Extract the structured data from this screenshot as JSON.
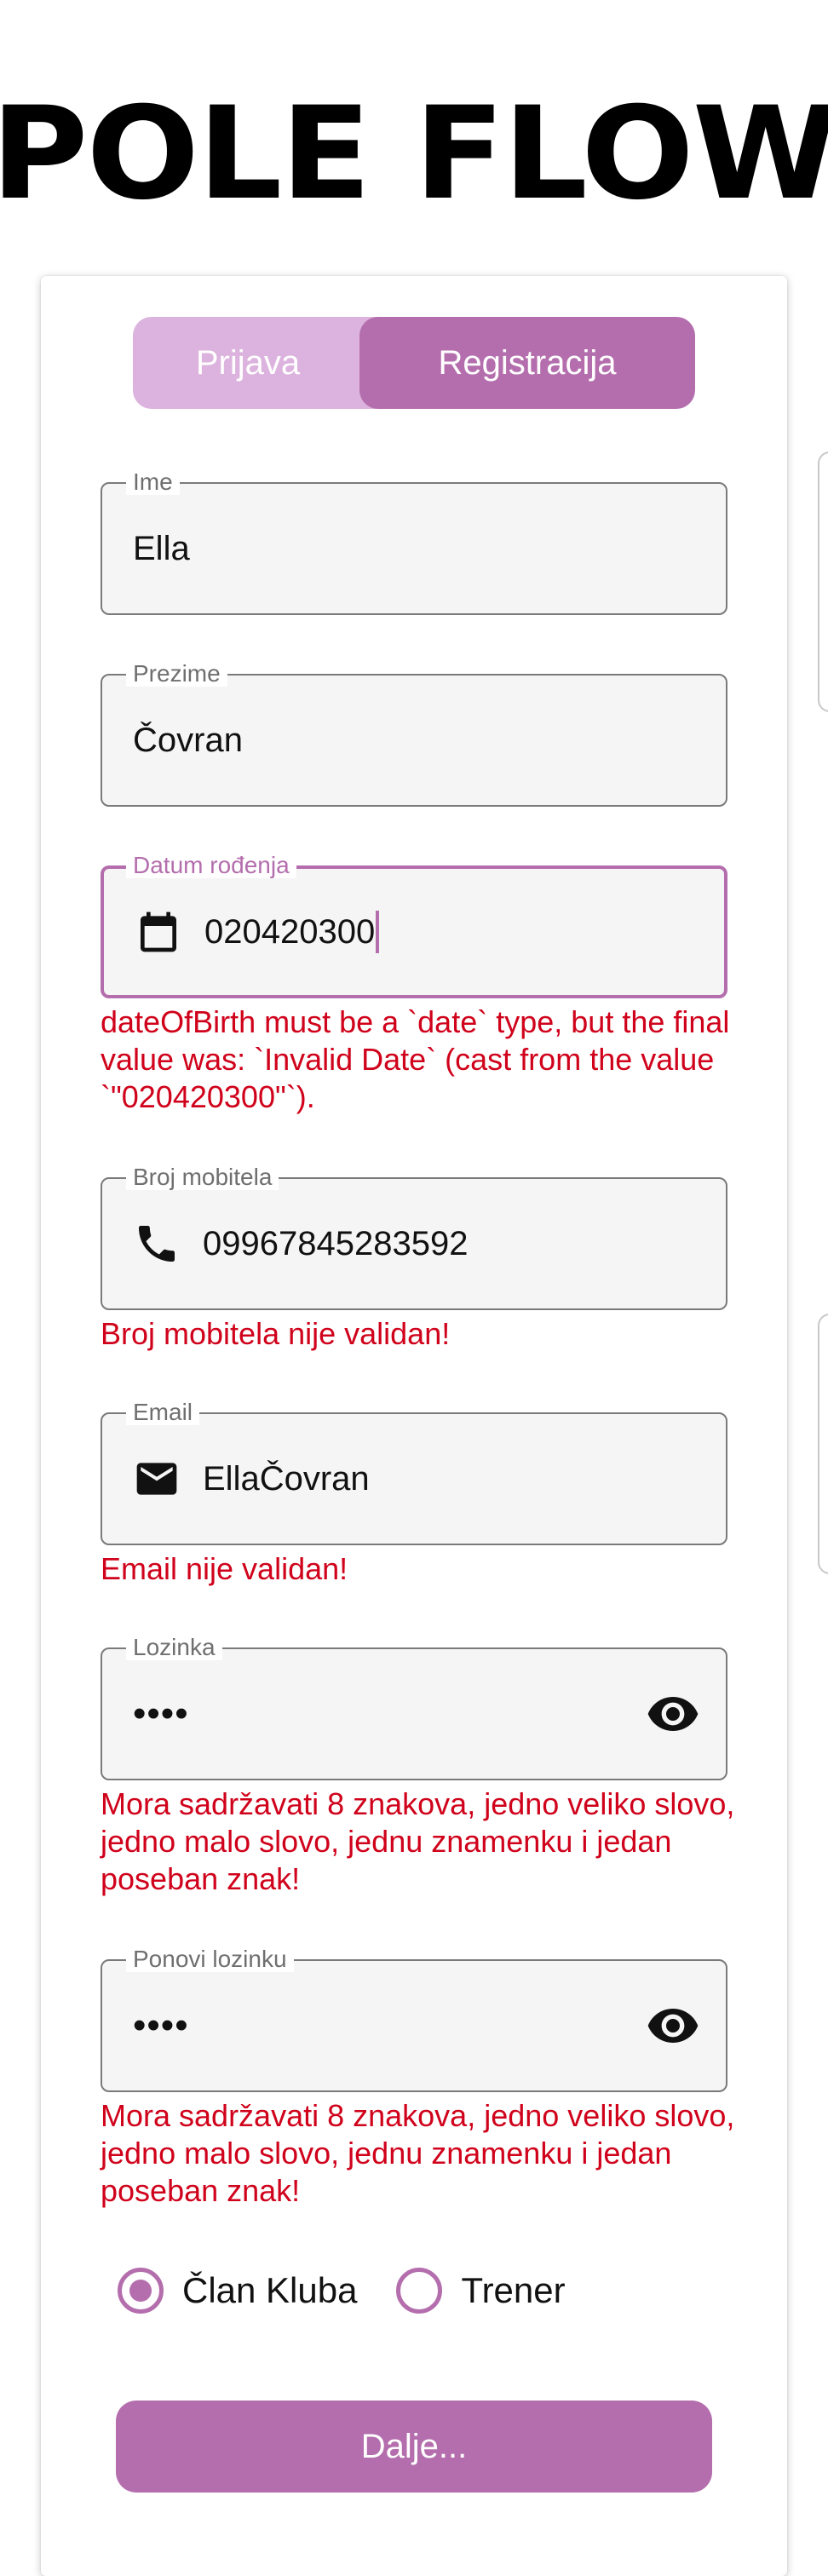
{
  "app": {
    "logo": "POLE FLOW"
  },
  "tabs": {
    "login": "Prijava",
    "register": "Registracija",
    "active": "register"
  },
  "form": {
    "first_name": {
      "label": "Ime",
      "value": "Ella"
    },
    "last_name": {
      "label": "Prezime",
      "value": "Čovran"
    },
    "date_of_birth": {
      "label": "Datum rođenja",
      "value": "020420300",
      "icon": "calendar-icon",
      "error": "dateOfBirth must be a `date` type, but the final value was: `Invalid Date` (cast from the value `\"020420300\"`)."
    },
    "phone": {
      "label": "Broj mobitela",
      "value": "09967845283592",
      "icon": "phone-icon",
      "error": "Broj mobitela nije validan!"
    },
    "email": {
      "label": "Email",
      "value": "EllaČovran",
      "icon": "mail-icon",
      "error": "Email nije validan!"
    },
    "password": {
      "label": "Lozinka",
      "value": "••••",
      "error": "Mora sadržavati 8 znakova, jedno veliko slovo, jedno malo slovo, jednu znamenku i jedan poseban znak!"
    },
    "repeat_password": {
      "label": "Ponovi lozinku",
      "value": "••••",
      "error": "Mora sadržavati 8 znakova, jedno veliko slovo, jedno malo slovo, jednu znamenku i jedan poseban znak!"
    },
    "role": {
      "options": [
        "Član Kluba",
        "Trener"
      ],
      "selected": "Član Kluba"
    },
    "submit_label": "Dalje..."
  },
  "colors": {
    "accent": "#b46ead",
    "tab_inactive": "#dcb2de",
    "error": "#d0021b",
    "field_bg": "#f5f5f5"
  }
}
